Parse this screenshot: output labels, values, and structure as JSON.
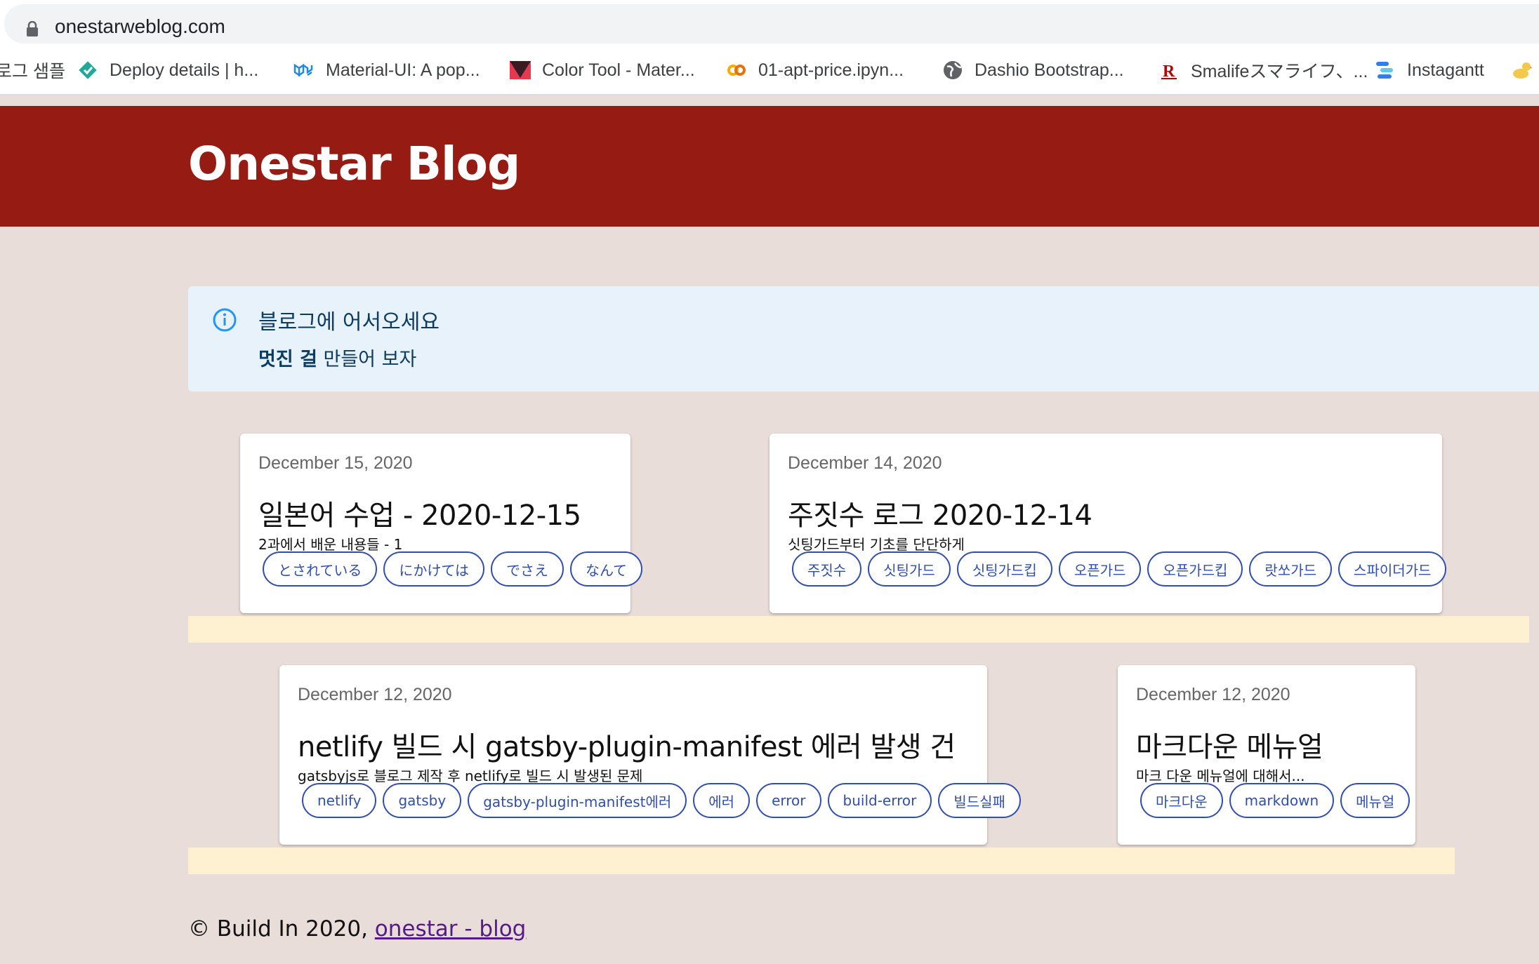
{
  "browser": {
    "url": "onestarweblog.com",
    "bookmarks": [
      {
        "label": "로그 샘플",
        "icon": "none"
      },
      {
        "label": "Deploy details | h...",
        "icon": "netlify-diamond-icon"
      },
      {
        "label": "Material-UI: A pop...",
        "icon": "material-ui-icon"
      },
      {
        "label": "Color Tool - Mater...",
        "icon": "color-tool-icon"
      },
      {
        "label": "01-apt-price.ipyn...",
        "icon": "colab-icon"
      },
      {
        "label": "Dashio Bootstrap...",
        "icon": "globe-icon"
      },
      {
        "label": "Smalifeスマライフ、...",
        "icon": "rakuten-icon"
      },
      {
        "label": "Instagantt",
        "icon": "instagantt-icon"
      }
    ]
  },
  "header": {
    "title": "Onestar Blog"
  },
  "alert": {
    "title": "블로그에 어서오세요",
    "body_bold": "멋진 걸",
    "body_rest": " 만들어 보자"
  },
  "posts": [
    {
      "date": "December 15, 2020",
      "title": "일본어 수업 - 2020-12-15",
      "description": "2과에서 배운 내용들 - 1",
      "tags": [
        "とされている",
        "にかけては",
        "でさえ",
        "なんて"
      ]
    },
    {
      "date": "December 14, 2020",
      "title": "주짓수 로그 2020-12-14",
      "description": "싯팅가드부터 기초를 단단하게",
      "tags": [
        "주짓수",
        "싯팅가드",
        "싯팅가드킵",
        "오픈가드",
        "오픈가드킵",
        "랏쏘가드",
        "스파이더가드"
      ]
    },
    {
      "date": "December 12, 2020",
      "title": "netlify 빌드 시 gatsby-plugin-manifest 에러 발생 건",
      "description": "gatsbyjs로 블로그 제작 후 netlify로 빌드 시 발생된 문제",
      "tags": [
        "netlify",
        "gatsby",
        "gatsby-plugin-manifest에러",
        "에러",
        "error",
        "build-error",
        "빌드실패"
      ]
    },
    {
      "date": "December 12, 2020",
      "title": "마크다운 메뉴얼",
      "description": "마크 다운 메뉴얼에 대해서...",
      "tags": [
        "마크다운",
        "markdown",
        "메뉴얼"
      ]
    }
  ],
  "footer": {
    "text": "© Build In 2020, ",
    "link": "onestar - blog"
  }
}
